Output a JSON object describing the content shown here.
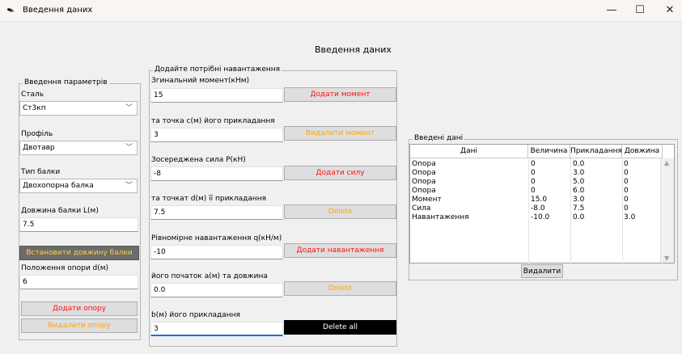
{
  "window": {
    "title": "Введення даних"
  },
  "heading": "Введення даних",
  "params": {
    "legend": "Введення параметрів",
    "steel_label": "Сталь",
    "steel_value": "Ст3кп",
    "profile_label": "Профіль",
    "profile_value": "Двотавр",
    "beam_type_label": "Тип балки",
    "beam_type_value": "Двохопорна балка",
    "length_label": "Довжина балки L(м)",
    "length_value": "7.5",
    "set_length_btn": "Встановити довжину балки",
    "support_pos_label": "Положення опори d(м)",
    "support_pos_value": "6",
    "add_support_btn": "Додати опору",
    "remove_support_btn": "Видалити опору"
  },
  "loads": {
    "legend": "Додайте потрібні навантаження",
    "moment_label": "Згинальний момент(кНм)",
    "moment_value": "15",
    "add_moment_btn": "Додати момент",
    "moment_point_label": "та точка c(м) його прикладання",
    "moment_point_value": "3",
    "remove_moment_btn": "Видалити момент",
    "force_label": "Зосереджена сила P(кН)",
    "force_value": "-8",
    "add_force_btn": "Додати силу",
    "force_point_label": "та точкат d(м) її прикладання",
    "force_point_value": "7.5",
    "delete_force_btn": "Delete",
    "dist_label": "Рівномірне навантаження q(кН/м)",
    "dist_value": "-10",
    "add_dist_btn": "Додати навантаження",
    "dist_start_label": "його початок a(м) та довжина",
    "dist_start_value": "0.0",
    "delete_dist_btn": "Delete",
    "dist_len_label": "b(м) його прикладання",
    "dist_len_value": "3",
    "delete_all_btn": "Delete all"
  },
  "entered": {
    "legend": "Введені дані",
    "columns": [
      "Дані",
      "Величина",
      "Прикладання",
      "Довжина"
    ],
    "rows": [
      [
        "Опора",
        "0",
        "0.0",
        "0"
      ],
      [
        "Опора",
        "0",
        "3.0",
        "0"
      ],
      [
        "Опора",
        "0",
        "5.0",
        "0"
      ],
      [
        "Опора",
        "0",
        "6.0",
        "0"
      ],
      [
        "Момент",
        "15.0",
        "3.0",
        "0"
      ],
      [
        "Сила",
        "-8.0",
        "7.5",
        "0"
      ],
      [
        "Навантаження",
        "-10.0",
        "0.0",
        "3.0"
      ]
    ],
    "delete_btn": "Видалити"
  },
  "icons": {
    "app": "feather-icon",
    "minimize": "minimize-icon",
    "maximize": "maximize-icon",
    "close": "close-icon",
    "dropdown": "chevron-down-icon",
    "scroll_up": "scroll-up-icon",
    "scroll_down": "scroll-down-icon"
  },
  "colors": {
    "red_text": "#ff1010",
    "orange_text": "#ffa500",
    "dark_button_bg": "#6b6b6b",
    "dark_button_text": "#ffd23f",
    "black_button_bg": "#000000"
  }
}
